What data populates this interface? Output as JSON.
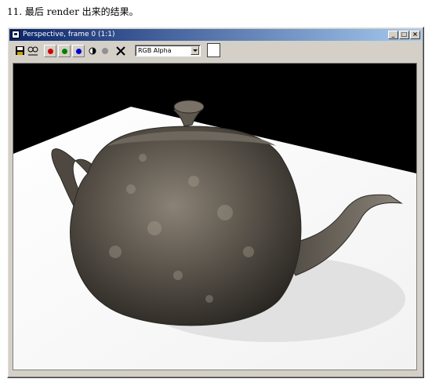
{
  "caption": "11. 最后 render 出来的结果。",
  "window": {
    "title": "Perspective, frame 0 (1:1)",
    "controls": {
      "minimize": "_",
      "maximize": "□",
      "close": "×"
    }
  },
  "toolbar": {
    "channel_select": "RGB Alpha",
    "icons": [
      "save-icon",
      "clone-icon",
      "red-channel-icon",
      "green-channel-icon",
      "blue-channel-icon",
      "mono-icon",
      "alpha-icon",
      "clear-icon"
    ],
    "colors": {
      "red": "#d00000",
      "green": "#008000",
      "blue": "#0000d0"
    }
  }
}
